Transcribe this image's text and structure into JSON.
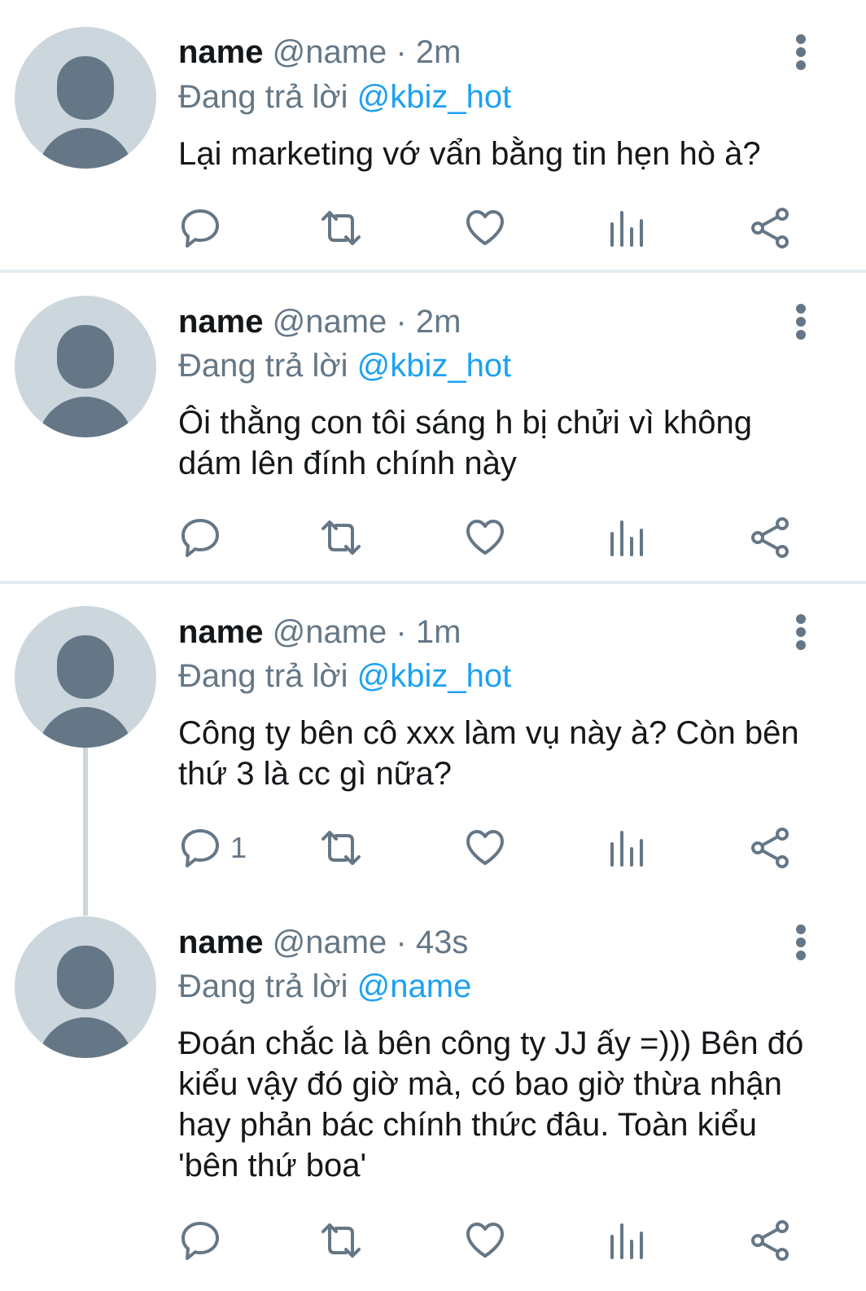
{
  "tweets": [
    {
      "name": "name",
      "handle": "@name",
      "time": "· 2m",
      "reply_prefix": "Đang trả lời",
      "reply_to": "@kbiz_hot",
      "text": "Lại marketing vớ vẩn bằng tin hẹn hò à?",
      "reply_count": ""
    },
    {
      "name": "name",
      "handle": "@name",
      "time": "· 2m",
      "reply_prefix": "Đang trả lời",
      "reply_to": "@kbiz_hot",
      "text": "Ôi thằng con tôi sáng h bị chửi vì không dám lên đính chính này",
      "reply_count": ""
    },
    {
      "name": "name",
      "handle": "@name",
      "time": "· 1m",
      "reply_prefix": "Đang trả lời",
      "reply_to": "@kbiz_hot",
      "text": "Công ty bên cô xxx làm vụ này à? Còn bên thứ 3 là cc gì nữa?",
      "reply_count": "1"
    },
    {
      "name": "name",
      "handle": "@name",
      "time": "· 43s",
      "reply_prefix": "Đang trả lời",
      "reply_to": "@name",
      "text": "Đoán chắc là bên công ty JJ ấy =))) Bên đó kiểu vậy đó giờ mà, có bao giờ thừa nhận hay phản bác chính thức đâu. Toàn kiểu 'bên thứ boa'",
      "reply_count": ""
    }
  ],
  "icons": {
    "avatar": "default-profile-icon",
    "more": "more-vertical-icon",
    "reply": "reply-icon",
    "retweet": "retweet-icon",
    "like": "heart-icon",
    "views": "analytics-icon",
    "share": "share-icon"
  },
  "colors": {
    "link": "#1da1f2",
    "secondary": "#657786",
    "avatar_bg": "#ccd6dd",
    "avatar_fg": "#657786",
    "divider": "#e6ecf0"
  }
}
